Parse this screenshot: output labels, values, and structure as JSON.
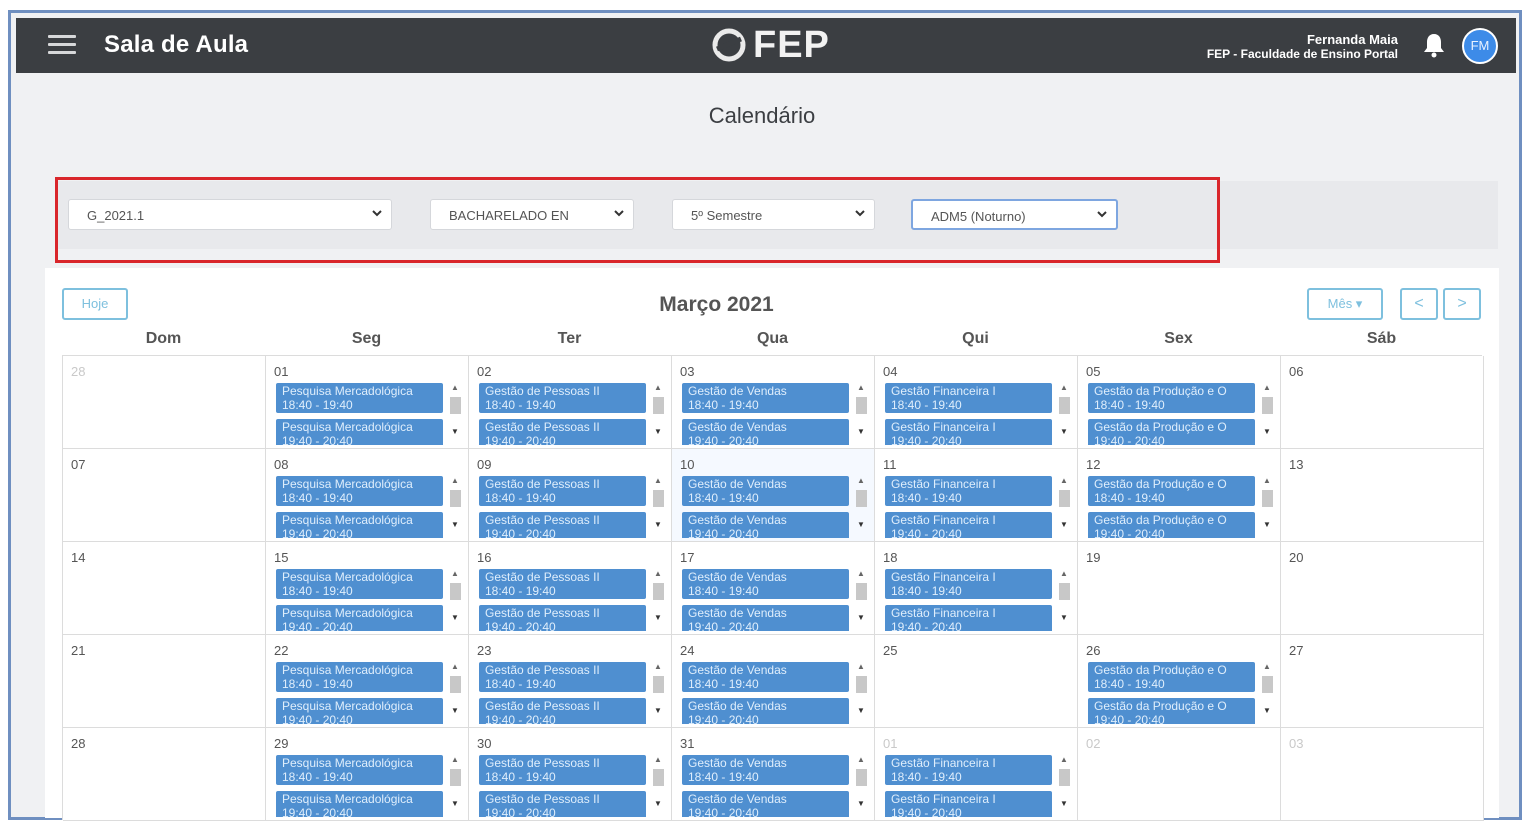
{
  "header": {
    "title": "Sala de Aula",
    "brand": "FEP",
    "brand_tagline": "Faculdade de Ensino Portal",
    "user_name": "Fernanda Maia",
    "institution": "FEP - Faculdade de Ensino Portal",
    "avatar_initials": "FM"
  },
  "page": {
    "title": "Calendário"
  },
  "filters": [
    {
      "value": "G_2021.1"
    },
    {
      "value": "BACHARELADO EN"
    },
    {
      "value": "5º Semestre"
    },
    {
      "value": "ADM5 (Noturno)"
    }
  ],
  "calendar": {
    "today_label": "Hoje",
    "month_title": "Março 2021",
    "view_label": "Mês ▾",
    "prev_label": "<",
    "next_label": ">",
    "weekdays": [
      "Dom",
      "Seg",
      "Ter",
      "Qua",
      "Qui",
      "Sex",
      "Sáb"
    ],
    "weeks": [
      [
        {
          "day": "28",
          "muted": true,
          "events": []
        },
        {
          "day": "01",
          "events": [
            [
              "Pesquisa Mercadológica",
              "18:40 - 19:40"
            ],
            [
              "Pesquisa Mercadológica",
              "19:40 - 20:40"
            ]
          ]
        },
        {
          "day": "02",
          "events": [
            [
              "Gestão de Pessoas II",
              "18:40 - 19:40"
            ],
            [
              "Gestão de Pessoas II",
              "19:40 - 20:40"
            ]
          ]
        },
        {
          "day": "03",
          "events": [
            [
              "Gestão de Vendas",
              "18:40 - 19:40"
            ],
            [
              "Gestão de Vendas",
              "19:40 - 20:40"
            ]
          ]
        },
        {
          "day": "04",
          "events": [
            [
              "Gestão Financeira I",
              "18:40 - 19:40"
            ],
            [
              "Gestão Financeira I",
              "19:40 - 20:40"
            ]
          ]
        },
        {
          "day": "05",
          "events": [
            [
              "Gestão da Produção e O",
              "18:40 - 19:40"
            ],
            [
              "Gestão da Produção e O",
              "19:40 - 20:40"
            ]
          ]
        },
        {
          "day": "06",
          "events": []
        }
      ],
      [
        {
          "day": "07",
          "events": []
        },
        {
          "day": "08",
          "events": [
            [
              "Pesquisa Mercadológica",
              "18:40 - 19:40"
            ],
            [
              "Pesquisa Mercadológica",
              "19:40 - 20:40"
            ]
          ]
        },
        {
          "day": "09",
          "events": [
            [
              "Gestão de Pessoas II",
              "18:40 - 19:40"
            ],
            [
              "Gestão de Pessoas II",
              "19:40 - 20:40"
            ]
          ]
        },
        {
          "day": "10",
          "today": true,
          "events": [
            [
              "Gestão de Vendas",
              "18:40 - 19:40"
            ],
            [
              "Gestão de Vendas",
              "19:40 - 20:40"
            ]
          ]
        },
        {
          "day": "11",
          "events": [
            [
              "Gestão Financeira I",
              "18:40 - 19:40"
            ],
            [
              "Gestão Financeira I",
              "19:40 - 20:40"
            ]
          ]
        },
        {
          "day": "12",
          "events": [
            [
              "Gestão da Produção e O",
              "18:40 - 19:40"
            ],
            [
              "Gestão da Produção e O",
              "19:40 - 20:40"
            ]
          ]
        },
        {
          "day": "13",
          "events": []
        }
      ],
      [
        {
          "day": "14",
          "events": []
        },
        {
          "day": "15",
          "events": [
            [
              "Pesquisa Mercadológica",
              "18:40 - 19:40"
            ],
            [
              "Pesquisa Mercadológica",
              "19:40 - 20:40"
            ]
          ]
        },
        {
          "day": "16",
          "events": [
            [
              "Gestão de Pessoas II",
              "18:40 - 19:40"
            ],
            [
              "Gestão de Pessoas II",
              "19:40 - 20:40"
            ]
          ]
        },
        {
          "day": "17",
          "events": [
            [
              "Gestão de Vendas",
              "18:40 - 19:40"
            ],
            [
              "Gestão de Vendas",
              "19:40 - 20:40"
            ]
          ]
        },
        {
          "day": "18",
          "events": [
            [
              "Gestão Financeira I",
              "18:40 - 19:40"
            ],
            [
              "Gestão Financeira I",
              "19:40 - 20:40"
            ]
          ]
        },
        {
          "day": "19",
          "events": []
        },
        {
          "day": "20",
          "events": []
        }
      ],
      [
        {
          "day": "21",
          "events": []
        },
        {
          "day": "22",
          "events": [
            [
              "Pesquisa Mercadológica",
              "18:40 - 19:40"
            ],
            [
              "Pesquisa Mercadológica",
              "19:40 - 20:40"
            ]
          ]
        },
        {
          "day": "23",
          "events": [
            [
              "Gestão de Pessoas II",
              "18:40 - 19:40"
            ],
            [
              "Gestão de Pessoas II",
              "19:40 - 20:40"
            ]
          ]
        },
        {
          "day": "24",
          "events": [
            [
              "Gestão de Vendas",
              "18:40 - 19:40"
            ],
            [
              "Gestão de Vendas",
              "19:40 - 20:40"
            ]
          ]
        },
        {
          "day": "25",
          "events": []
        },
        {
          "day": "26",
          "events": [
            [
              "Gestão da Produção e O",
              "18:40 - 19:40"
            ],
            [
              "Gestão da Produção e O",
              "19:40 - 20:40"
            ]
          ]
        },
        {
          "day": "27",
          "events": []
        }
      ],
      [
        {
          "day": "28",
          "events": []
        },
        {
          "day": "29",
          "events": [
            [
              "Pesquisa Mercadológica",
              "18:40 - 19:40"
            ],
            [
              "Pesquisa Mercadológica",
              "19:40 - 20:40"
            ]
          ]
        },
        {
          "day": "30",
          "events": [
            [
              "Gestão de Pessoas II",
              "18:40 - 19:40"
            ],
            [
              "Gestão de Pessoas II",
              "19:40 - 20:40"
            ]
          ]
        },
        {
          "day": "31",
          "events": [
            [
              "Gestão de Vendas",
              "18:40 - 19:40"
            ],
            [
              "Gestão de Vendas",
              "19:40 - 20:40"
            ]
          ]
        },
        {
          "day": "01",
          "muted": true,
          "events": [
            [
              "Gestão Financeira I",
              "18:40 - 19:40"
            ],
            [
              "Gestão Financeira I",
              "19:40 - 20:40"
            ]
          ]
        },
        {
          "day": "02",
          "muted": true,
          "events": []
        },
        {
          "day": "03",
          "muted": true,
          "events": []
        }
      ]
    ]
  },
  "colors": {
    "topbar": "#3b3e42",
    "event": "#4f8fd0",
    "highlight_border": "#d9262b",
    "button_outline": "#7ec0de"
  }
}
